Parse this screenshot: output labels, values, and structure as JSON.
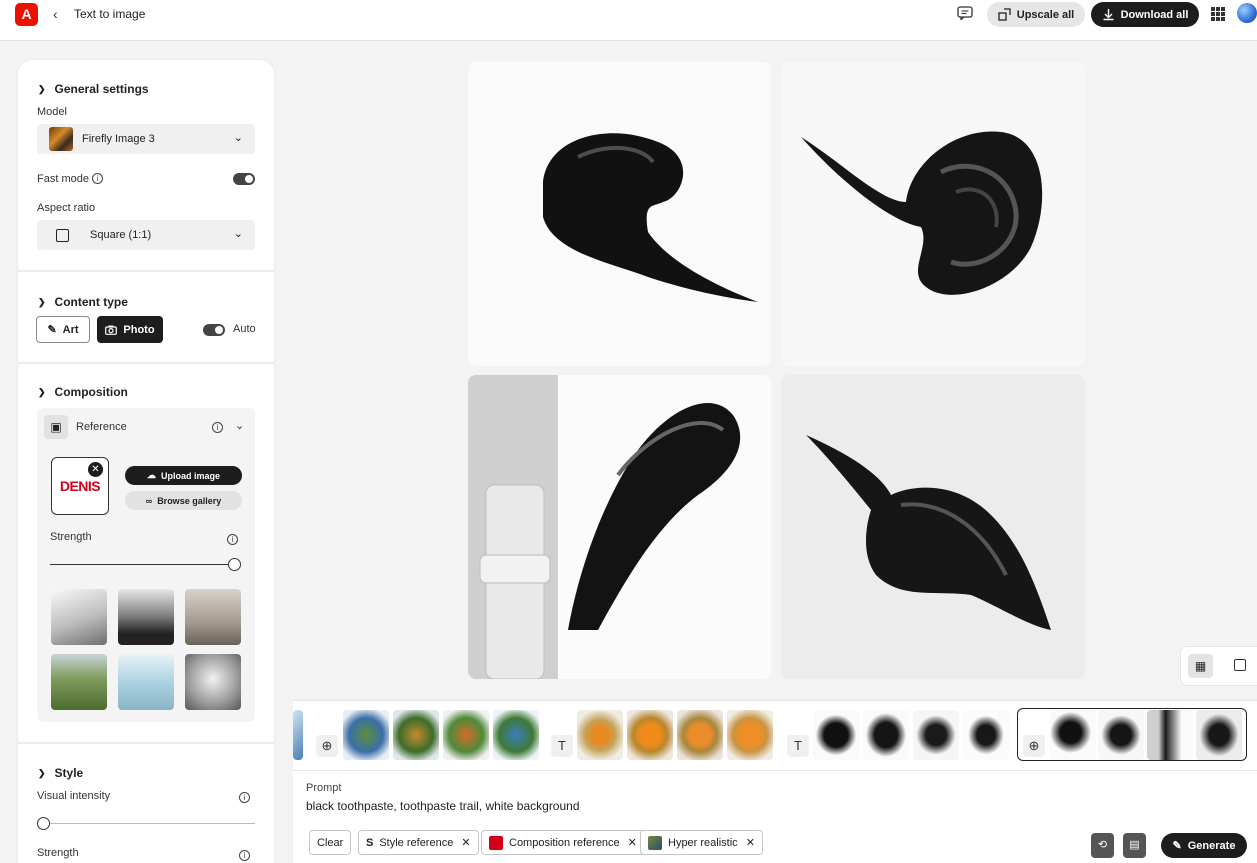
{
  "app": {
    "logo_letter": "A",
    "breadcrumb": "Text to image"
  },
  "header": {
    "upscale_label": "Upscale all",
    "download_label": "Download all"
  },
  "settings": {
    "general": {
      "title": "General settings",
      "model_label": "Model",
      "model_value": "Firefly Image 3",
      "fast_mode_label": "Fast mode",
      "fast_mode_on": true,
      "aspect_label": "Aspect ratio",
      "aspect_value": "Square (1:1)"
    },
    "content_type": {
      "title": "Content type",
      "art_label": "Art",
      "photo_label": "Photo",
      "selected": "Photo",
      "auto_label": "Auto",
      "auto_on": true
    },
    "composition": {
      "title": "Composition",
      "reference_label": "Reference",
      "reference_image_text": "DENIS",
      "upload_label": "Upload image",
      "browse_label": "Browse gallery",
      "strength_label": "Strength",
      "strength_value": 1.0
    },
    "style": {
      "title": "Style",
      "visual_intensity_label": "Visual intensity",
      "visual_intensity_value": 0.0,
      "strength_label": "Strength"
    }
  },
  "prompt": {
    "label": "Prompt",
    "text": "black toothpaste, toothpaste trail, white background",
    "clear_label": "Clear",
    "chips": [
      {
        "label": "Style reference"
      },
      {
        "label": "Composition reference"
      },
      {
        "label": "Hyper realistic"
      }
    ],
    "generate_label": "Generate"
  },
  "colors": {
    "accent_dark": "#1d1d1d",
    "adobe_red": "#eb1000",
    "denis_red": "#d4001a"
  }
}
